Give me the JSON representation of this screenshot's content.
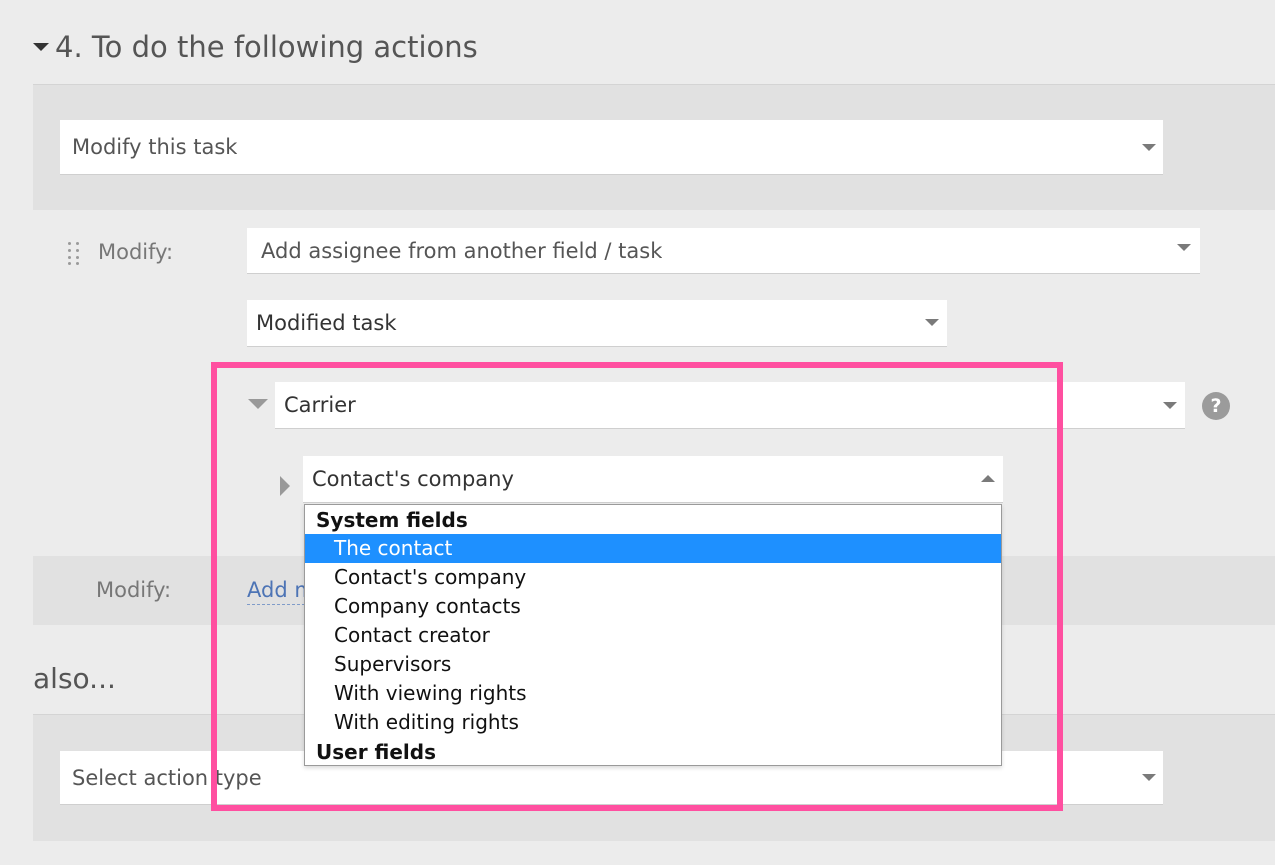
{
  "section": {
    "title": "4. To do the following actions"
  },
  "action_select": {
    "value": "Modify this task"
  },
  "modify_row": {
    "label": "Modify:",
    "type_select": {
      "value": "Add assignee from another field / task"
    },
    "source_select": {
      "value": "Modified task"
    },
    "field_select": {
      "value": "Carrier"
    },
    "subfield_select": {
      "value": "Contact's company"
    }
  },
  "modify_row_2": {
    "label": "Modify:",
    "add_link": "Add m"
  },
  "dropdown": {
    "groups": [
      {
        "label": "System fields",
        "items": [
          "The contact",
          "Contact's company",
          "Company contacts",
          "Contact creator",
          "Supervisors",
          "With viewing rights",
          "With editing rights"
        ]
      },
      {
        "label": "User fields",
        "items": []
      }
    ],
    "selected_index": 0
  },
  "also": {
    "title": "also..."
  },
  "action_type_select": {
    "placeholder": "Select action type"
  },
  "colors": {
    "highlight": "#ff4fa0",
    "selected_item": "#1e90ff",
    "link": "#4d74b5"
  }
}
